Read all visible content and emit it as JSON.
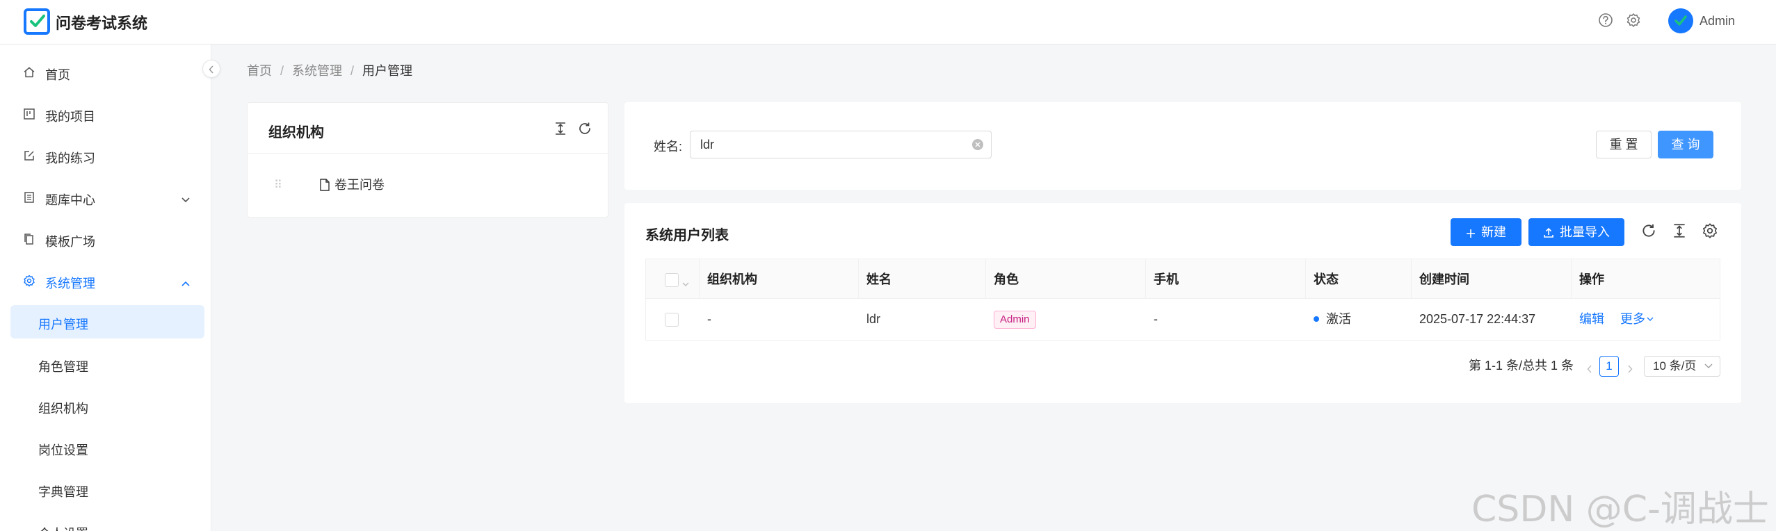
{
  "app": {
    "title": "问卷考试系统",
    "user_name": "Admin"
  },
  "header": {
    "icons": [
      "help-icon",
      "settings-icon"
    ]
  },
  "sidebar": {
    "items": [
      {
        "label": "首页",
        "icon": "home-icon"
      },
      {
        "label": "我的项目",
        "icon": "project-icon"
      },
      {
        "label": "我的练习",
        "icon": "edit-icon"
      },
      {
        "label": "题库中心",
        "icon": "book-icon",
        "expandable": true
      },
      {
        "label": "模板广场",
        "icon": "copy-icon"
      },
      {
        "label": "系统管理",
        "icon": "gear-icon",
        "expanded": true
      }
    ],
    "sub_items": [
      {
        "label": "用户管理",
        "active": true
      },
      {
        "label": "角色管理"
      },
      {
        "label": "组织机构"
      },
      {
        "label": "岗位设置"
      },
      {
        "label": "字典管理"
      },
      {
        "label": "个人设置"
      }
    ]
  },
  "breadcrumb": [
    "首页",
    "系统管理",
    "用户管理"
  ],
  "org_panel": {
    "title": "组织机构",
    "tree": [
      "卷王问卷"
    ]
  },
  "search": {
    "label": "姓名:",
    "value": "ldr",
    "reset_label": "重 置",
    "query_label": "查 询"
  },
  "user_list": {
    "title": "系统用户列表",
    "new_label": "新建",
    "import_label": "批量导入",
    "columns": [
      "组织机构",
      "姓名",
      "角色",
      "手机",
      "状态",
      "创建时间",
      "操作"
    ],
    "rows": [
      {
        "org": "-",
        "name": "ldr",
        "role": "Admin",
        "phone": "-",
        "status": "激活",
        "created": "2025-07-17 22:44:37",
        "edit": "编辑",
        "more": "更多"
      }
    ],
    "pagination": {
      "summary": "第 1-1 条/总共 1 条",
      "current_page": "1",
      "page_size": "10 条/页"
    }
  },
  "watermark": "CSDN @C-调战士",
  "colors": {
    "primary": "#1677ff",
    "tag_pink": "#c41d7f"
  }
}
